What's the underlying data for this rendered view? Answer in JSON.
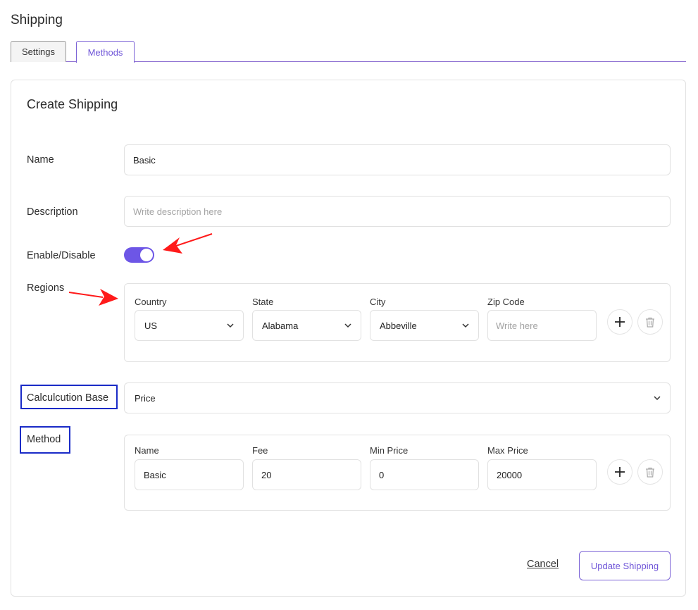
{
  "page": {
    "title": "Shipping"
  },
  "tabs": [
    {
      "label": "Settings",
      "active": false
    },
    {
      "label": "Methods",
      "active": true
    }
  ],
  "form": {
    "title": "Create Shipping",
    "name": {
      "label": "Name",
      "value": "Basic"
    },
    "description": {
      "label": "Description",
      "placeholder": "Write description here"
    },
    "enable": {
      "label": "Enable/Disable",
      "on": true
    },
    "regions": {
      "label": "Regions",
      "columns": {
        "country": "Country",
        "state": "State",
        "city": "City",
        "zip": "Zip Code"
      },
      "values": {
        "country": "US",
        "state": "Alabama",
        "city": "Abbeville",
        "zip_placeholder": "Write here"
      }
    },
    "calculation_base": {
      "label": "Calculcution Base",
      "value": "Price"
    },
    "method": {
      "label": "Method",
      "columns": {
        "name": "Name",
        "fee": "Fee",
        "min_price": "Min Price",
        "max_price": "Max Price"
      },
      "values": {
        "name": "Basic",
        "fee": "20",
        "min_price": "0",
        "max_price": "20000"
      }
    },
    "actions": {
      "cancel": "Cancel",
      "update": "Update Shipping"
    }
  },
  "colors": {
    "accent": "#6d56e6",
    "highlight_box": "#1a2bc7",
    "annotation_arrow": "#ff0000"
  }
}
